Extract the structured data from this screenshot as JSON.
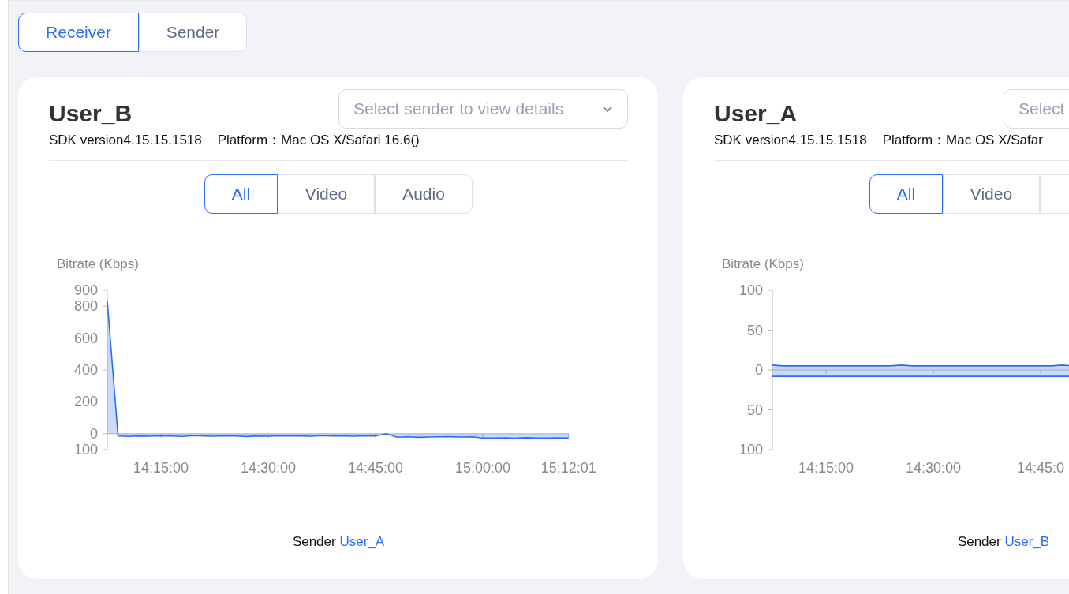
{
  "view_tabs": [
    {
      "label": "Receiver",
      "selected": true
    },
    {
      "label": "Sender",
      "selected": false
    }
  ],
  "cards": [
    {
      "title": "User_B",
      "select_placeholder": "Select sender to view details",
      "dropdown_arrow": true,
      "sdk": "SDK version4.15.15.1518",
      "platform_label": "Platform：",
      "platform_value": "Mac OS X/Safari 16.6()",
      "tabs": [
        {
          "label": "All",
          "selected": true
        },
        {
          "label": "Video",
          "selected": false
        },
        {
          "label": "Audio",
          "selected": false
        }
      ],
      "chart_data": {
        "type": "area",
        "ylabel": "Bitrate (Kbps)",
        "ylim": [
          -100,
          900
        ],
        "categories": [
          null,
          null,
          null,
          null,
          null,
          "14:15:00",
          null,
          null,
          null,
          null,
          null,
          null,
          null,
          null,
          null,
          "14:30:00",
          null,
          null,
          null,
          null,
          null,
          null,
          null,
          null,
          null,
          "14:45:00",
          null,
          null,
          null,
          null,
          null,
          null,
          null,
          null,
          null,
          "15:00:00",
          null,
          null,
          null,
          null,
          null,
          null,
          null,
          "15:12:01"
        ],
        "series": [
          {
            "color": "#2a6df4",
            "values": [
              830,
              -15,
              -17,
              -14,
              -16,
              -13,
              -15,
              -17,
              -12,
              -14,
              -16,
              -13,
              -15,
              -18,
              -14,
              -16,
              -13,
              -15,
              -14,
              -16,
              -12,
              -15,
              -14,
              -16,
              -13,
              -15,
              0,
              -22,
              -20,
              -23,
              -21,
              -20,
              -19,
              -21,
              -20,
              -27,
              -27,
              -26,
              -28,
              -25,
              -27,
              -27,
              -26,
              -27
            ]
          }
        ],
        "yticks": [
          {
            "value": 900,
            "label": "900"
          },
          {
            "value": 800,
            "label": "800"
          },
          {
            "value": 600,
            "label": "600"
          },
          {
            "value": 400,
            "label": "400"
          },
          {
            "value": 200,
            "label": "200"
          },
          {
            "value": 0,
            "label": "0"
          },
          {
            "value": -100,
            "label": "100"
          }
        ]
      },
      "footer_label": "Sender",
      "footer_link": "User_A"
    },
    {
      "title": "User_A",
      "select_placeholder": "Select",
      "dropdown_arrow": false,
      "sdk": "SDK version4.15.15.1518",
      "platform_label": "Platform：",
      "platform_value": "Mac OS X/Safar",
      "tabs": [
        {
          "label": "All",
          "selected": true
        },
        {
          "label": "Video",
          "selected": false
        },
        {
          "selected": false
        }
      ],
      "chart_data": {
        "type": "area",
        "ylabel": "Bitrate (Kbps)",
        "ylim": [
          -100,
          100
        ],
        "categories": [
          null,
          null,
          null,
          null,
          null,
          "14:15:00",
          null,
          null,
          null,
          null,
          null,
          null,
          null,
          null,
          null,
          "14:30:00",
          null,
          null,
          null,
          null,
          null,
          null,
          null,
          null,
          null,
          "14:45:0",
          null,
          null,
          null
        ],
        "series": [
          {
            "color": "#2a6df4",
            "values": [
              6,
              5,
              5,
              5,
              5,
              5,
              5,
              5,
              5,
              5,
              5,
              5,
              6,
              5,
              5,
              5,
              5,
              5,
              5,
              5,
              5,
              5,
              5,
              5,
              5,
              5,
              5,
              6,
              5
            ]
          },
          {
            "color": "#2a6df4",
            "values": [
              -8,
              -8,
              -8,
              -8,
              -8,
              -8,
              -8,
              -8,
              -8,
              -8,
              -8,
              -8,
              -8,
              -8,
              -8,
              -8,
              -8,
              -8,
              -8,
              -8,
              -8,
              -8,
              -8,
              -8,
              -8,
              -8,
              -8,
              -8,
              -8
            ]
          }
        ],
        "yticks": [
          {
            "value": 100,
            "label": "100"
          },
          {
            "value": 50,
            "label": "50"
          },
          {
            "value": 0,
            "label": "0"
          },
          {
            "value": -50,
            "label": "50"
          },
          {
            "value": -100,
            "label": "100"
          }
        ]
      },
      "footer_label": "Sender",
      "footer_link": "User_B"
    }
  ]
}
